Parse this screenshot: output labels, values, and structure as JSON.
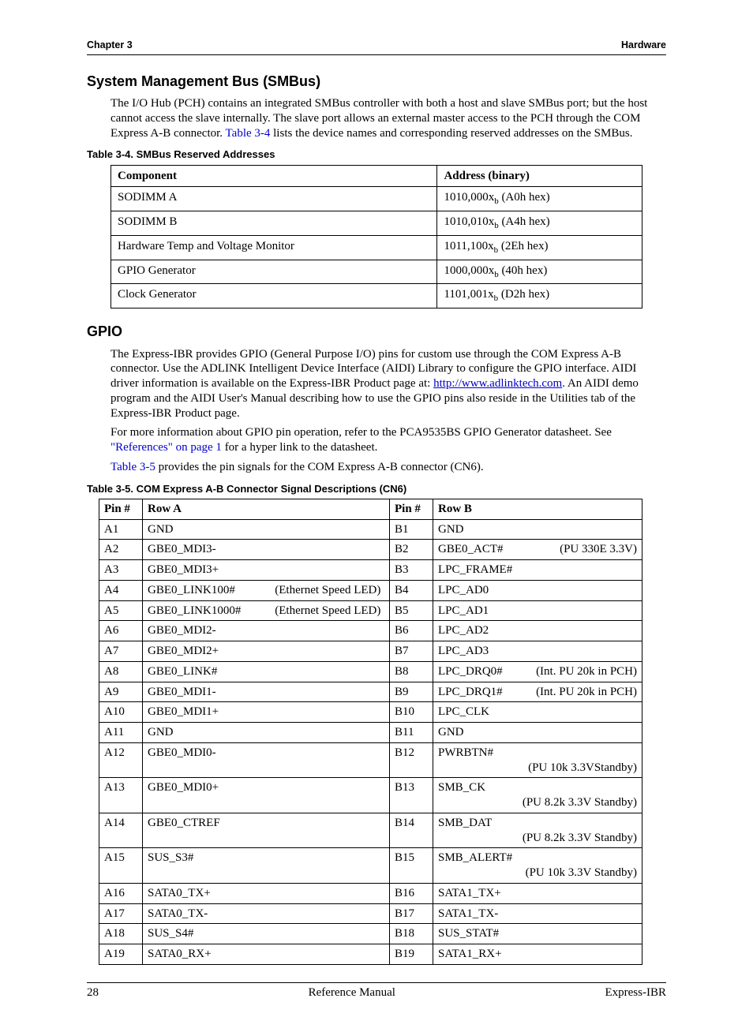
{
  "header": {
    "left": "Chapter 3",
    "right": "Hardware"
  },
  "footer": {
    "left": "28",
    "center": "Reference Manual",
    "right": "Express-IBR"
  },
  "sec1": {
    "title": "System Management Bus (SMBus)",
    "para_a": "The I/O Hub (PCH) contains an integrated SMBus controller with both a host and slave SMBus port; but the host cannot access the slave internally. The slave port allows an external master access to the PCH through the COM Express A-B connector. ",
    "xref": "Table 3-4",
    "para_b": " lists the device names and corresponding reserved addresses on the SMBus.",
    "table_caption": "Table 3-4.   SMBus Reserved Addresses",
    "th1": "Component",
    "th2": "Address (binary)"
  },
  "t34": [
    {
      "c": "SODIMM A",
      "a": "1010,000x",
      "h": " (A0h hex)"
    },
    {
      "c": "SODIMM B",
      "a": "1010,010x",
      "h": " (A4h hex)"
    },
    {
      "c": "Hardware Temp and Voltage Monitor",
      "a": "1011,100x",
      "h": " (2Eh hex)"
    },
    {
      "c": "GPIO Generator",
      "a": "1000,000x",
      "h": " (40h hex)"
    },
    {
      "c": "Clock Generator",
      "a": "1101,001x",
      "h": " (D2h hex)"
    }
  ],
  "sec2": {
    "title": "GPIO",
    "p1a": "The Express-IBR provides GPIO (General Purpose I/O) pins for custom use through the COM Express A-B connector. Use the ADLINK Intelligent Device Interface (AIDI) Library to configure the GPIO interface. AIDI driver information is available on the Express-IBR Product page at: ",
    "url": "http://www.adlinktech.com",
    "p1b": ". An AIDI demo program and the AIDI User's Manual describing how to use the GPIO pins also reside in the Utilities tab of the Express-IBR Product page.",
    "p2a": "For more information about GPIO pin operation, refer to the PCA9535BS GPIO Generator datasheet. See ",
    "p2ref": "\"References\" on page 1",
    "p2b": " for a hyper link to the datasheet.",
    "p3ref": "Table 3-5",
    "p3b": " provides the pin signals for the COM Express A-B connector (CN6).",
    "table_caption": "Table 3-5.   COM Express A-B Connector Signal Descriptions (CN6)",
    "th_pin": "Pin #",
    "th_rowA": "Row A",
    "th_rowB": "Row B"
  },
  "t35": [
    {
      "pA": "A1",
      "sA": "GND",
      "nA": "",
      "pB": "B1",
      "sB": "GND",
      "nB": ""
    },
    {
      "pA": "A2",
      "sA": "GBE0_MDI3-",
      "nA": "",
      "pB": "B2",
      "sB": "GBE0_ACT#",
      "nB": "(PU 330E 3.3V)"
    },
    {
      "pA": "A3",
      "sA": "GBE0_MDI3+",
      "nA": "",
      "pB": "B3",
      "sB": "LPC_FRAME#",
      "nB": ""
    },
    {
      "pA": "A4",
      "sA": "GBE0_LINK100#",
      "nA": "(Ethernet Speed LED)",
      "pB": "B4",
      "sB": "LPC_AD0",
      "nB": ""
    },
    {
      "pA": "A5",
      "sA": "GBE0_LINK1000#",
      "nA": "(Ethernet Speed LED)",
      "pB": "B5",
      "sB": "LPC_AD1",
      "nB": ""
    },
    {
      "pA": "A6",
      "sA": "GBE0_MDI2-",
      "nA": "",
      "pB": "B6",
      "sB": "LPC_AD2",
      "nB": ""
    },
    {
      "pA": "A7",
      "sA": "GBE0_MDI2+",
      "nA": "",
      "pB": "B7",
      "sB": "LPC_AD3",
      "nB": ""
    },
    {
      "pA": "A8",
      "sA": "GBE0_LINK#",
      "nA": "",
      "pB": "B8",
      "sB": "LPC_DRQ0#",
      "nB": "(Int. PU 20k in PCH)"
    },
    {
      "pA": "A9",
      "sA": "GBE0_MDI1-",
      "nA": "",
      "pB": "B9",
      "sB": "LPC_DRQ1#",
      "nB": "(Int. PU 20k in PCH)"
    },
    {
      "pA": "A10",
      "sA": "GBE0_MDI1+",
      "nA": "",
      "pB": "B10",
      "sB": "LPC_CLK",
      "nB": ""
    },
    {
      "pA": "A11",
      "sA": "GND",
      "nA": "",
      "pB": "B11",
      "sB": "GND",
      "nB": ""
    },
    {
      "pA": "A12",
      "sA": "GBE0_MDI0-",
      "nA": "",
      "pB": "B12",
      "sB": "PWRBTN#",
      "nB": "(PU 10k 3.3VStandby)"
    },
    {
      "pA": "A13",
      "sA": "GBE0_MDI0+",
      "nA": "",
      "pB": "B13",
      "sB": "SMB_CK",
      "nB": "(PU 8.2k 3.3V Standby)"
    },
    {
      "pA": "A14",
      "sA": "GBE0_CTREF",
      "nA": "",
      "pB": "B14",
      "sB": "SMB_DAT",
      "nB": "(PU 8.2k 3.3V Standby)"
    },
    {
      "pA": "A15",
      "sA": "SUS_S3#",
      "nA": "",
      "pB": "B15",
      "sB": "SMB_ALERT#",
      "nB": "(PU 10k 3.3V Standby)"
    },
    {
      "pA": "A16",
      "sA": "SATA0_TX+",
      "nA": "",
      "pB": "B16",
      "sB": "SATA1_TX+",
      "nB": ""
    },
    {
      "pA": "A17",
      "sA": "SATA0_TX-",
      "nA": "",
      "pB": "B17",
      "sB": "SATA1_TX-",
      "nB": ""
    },
    {
      "pA": "A18",
      "sA": "SUS_S4#",
      "nA": "",
      "pB": "B18",
      "sB": "SUS_STAT#",
      "nB": ""
    },
    {
      "pA": "A19",
      "sA": "SATA0_RX+",
      "nA": "",
      "pB": "B19",
      "sB": "SATA1_RX+",
      "nB": ""
    }
  ]
}
